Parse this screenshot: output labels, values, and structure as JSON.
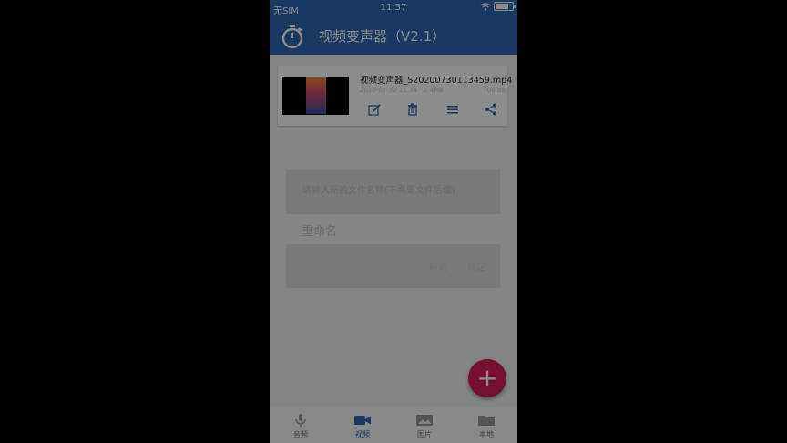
{
  "status_bar": {
    "carrier": "无SIM",
    "time": "11:37",
    "battery_level": 0.75
  },
  "app_bar": {
    "title": "视频变声器（V2.1）",
    "logo_icon": "stopwatch-icon"
  },
  "file_card": {
    "file_name": "视频变声器_S20200730113459.mp4",
    "meta_left": "2020-07-30 11:34 · 2.4MB",
    "meta_right": "00:08",
    "actions": [
      {
        "name": "edit-icon"
      },
      {
        "name": "delete-icon"
      },
      {
        "name": "menu-icon"
      },
      {
        "name": "share-icon"
      }
    ]
  },
  "dialog": {
    "message": "请输入新的文件名称(不需要文件后缀)",
    "input_value": "重命名",
    "cancel_label": "取消",
    "confirm_label": "确定"
  },
  "fab": {
    "label": "+",
    "icon": "plus-icon"
  },
  "bottom_nav": {
    "items": [
      {
        "label": "音频",
        "icon": "audio-icon",
        "active": false
      },
      {
        "label": "视频",
        "icon": "video-camera-icon",
        "active": true
      },
      {
        "label": "图片",
        "icon": "image-icon",
        "active": false
      },
      {
        "label": "本地",
        "icon": "folder-icon",
        "active": false
      }
    ]
  },
  "colors": {
    "primary": "#2f69b4",
    "accent": "#d61e57"
  }
}
